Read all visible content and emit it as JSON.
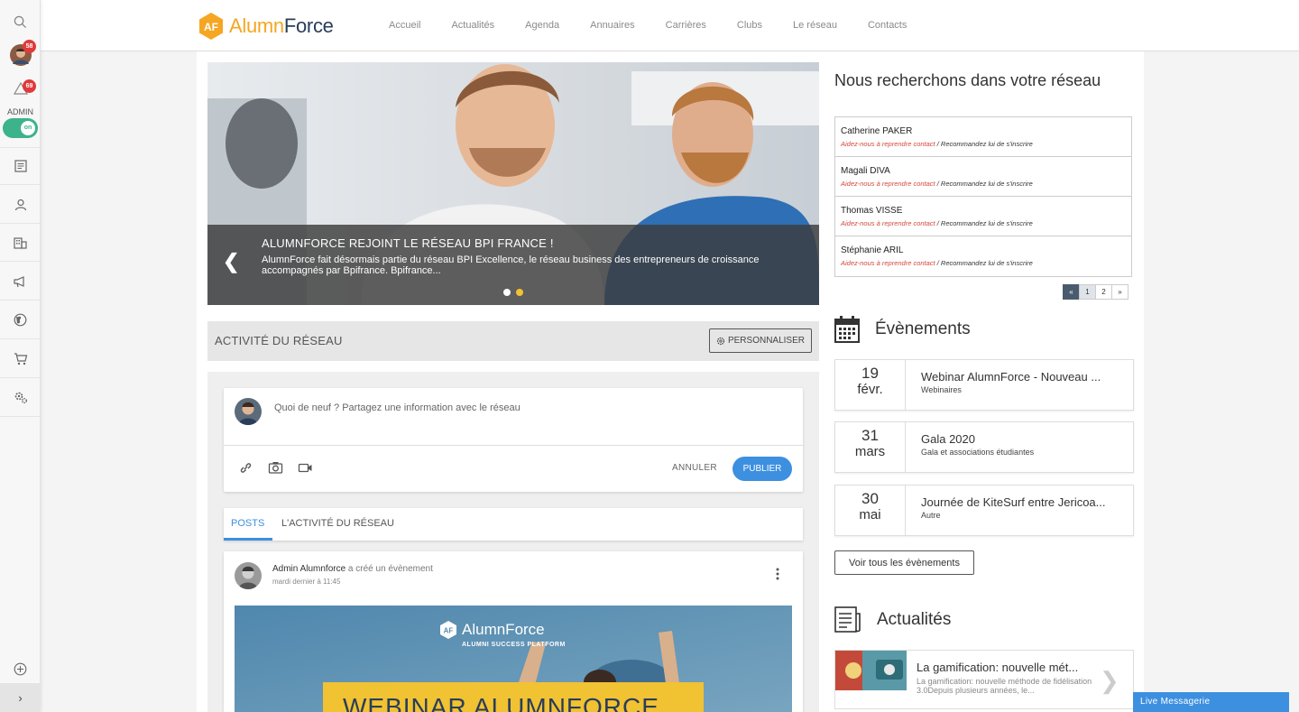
{
  "rail": {
    "notifications_count": "58",
    "alerts_count": "69",
    "admin_label": "ADMIN",
    "toggle_label": "on",
    "expand_label": "›"
  },
  "brand": {
    "name_part1": "Alumn",
    "name_part2": "Force",
    "badge": "AF"
  },
  "nav": {
    "items": [
      "Accueil",
      "Actualités",
      "Agenda",
      "Annuaires",
      "Carrières",
      "Clubs",
      "Le réseau",
      "Contacts"
    ]
  },
  "hero": {
    "title": "ALUMNFORCE REJOINT LE RÉSEAU BPI FRANCE !",
    "text": "AlumnForce fait désormais partie du réseau BPI Excellence, le réseau business des entrepreneurs de croissance accompagnés par Bpifrance. Bpifrance...",
    "prev": "❮"
  },
  "activity": {
    "title": "ACTIVITÉ DU RÉSEAU",
    "personalize": "PERSONNALISER",
    "composer_placeholder": "Quoi de neuf ? Partagez une information avec le réseau",
    "cancel": "ANNULER",
    "publish": "PUBLIER",
    "tabs": [
      "POSTS",
      "L'ACTIVITÉ DU RÉSEAU"
    ]
  },
  "post": {
    "author": "Admin Alumnforce",
    "action": " a créé un évènement",
    "time": "mardi dernier à 11:45",
    "image_brand": "AlumnForce",
    "image_sub": "ALUMNI SUCCESS PLATFORM",
    "image_banner": "WEBINAR ALUMNFORCE"
  },
  "recommend": {
    "title": "Nous recherchons dans votre réseau",
    "link_contact": "Aidez-nous à reprendre contact",
    "link_sep": " / ",
    "link_invite": "Recommandez lui de s'inscrire",
    "people": [
      "Catherine PAKER",
      "Magali DIVA",
      "Thomas VISSE",
      "Stéphanie ARIL"
    ],
    "pager": [
      "«",
      "1",
      "2",
      "»"
    ]
  },
  "events": {
    "title": "Évènements",
    "items": [
      {
        "day": "19",
        "month": "févr.",
        "title": "Webinar AlumnForce - Nouveau ...",
        "category": "Webinaires"
      },
      {
        "day": "31",
        "month": "mars",
        "title": "Gala 2020",
        "category": "Gala et associations étudiantes"
      },
      {
        "day": "30",
        "month": "mai",
        "title": "Journée de KiteSurf entre Jericoa...",
        "category": "Autre"
      }
    ],
    "see_all": "Voir tous les évènements"
  },
  "news": {
    "title": "Actualités",
    "items": [
      {
        "title": "La gamification: nouvelle mét...",
        "desc": "La gamification: nouvelle méthode de fidélisation 3.0Depuis plusieurs années, le..."
      }
    ]
  },
  "live_messaging": "Live Messagerie",
  "colors": {
    "accent": "#3d8fe0",
    "brand_orange": "#f5a623",
    "brand_navy": "#2a3d5a",
    "toggle_green": "#3cb38a",
    "badge_red": "#e03a3a"
  }
}
